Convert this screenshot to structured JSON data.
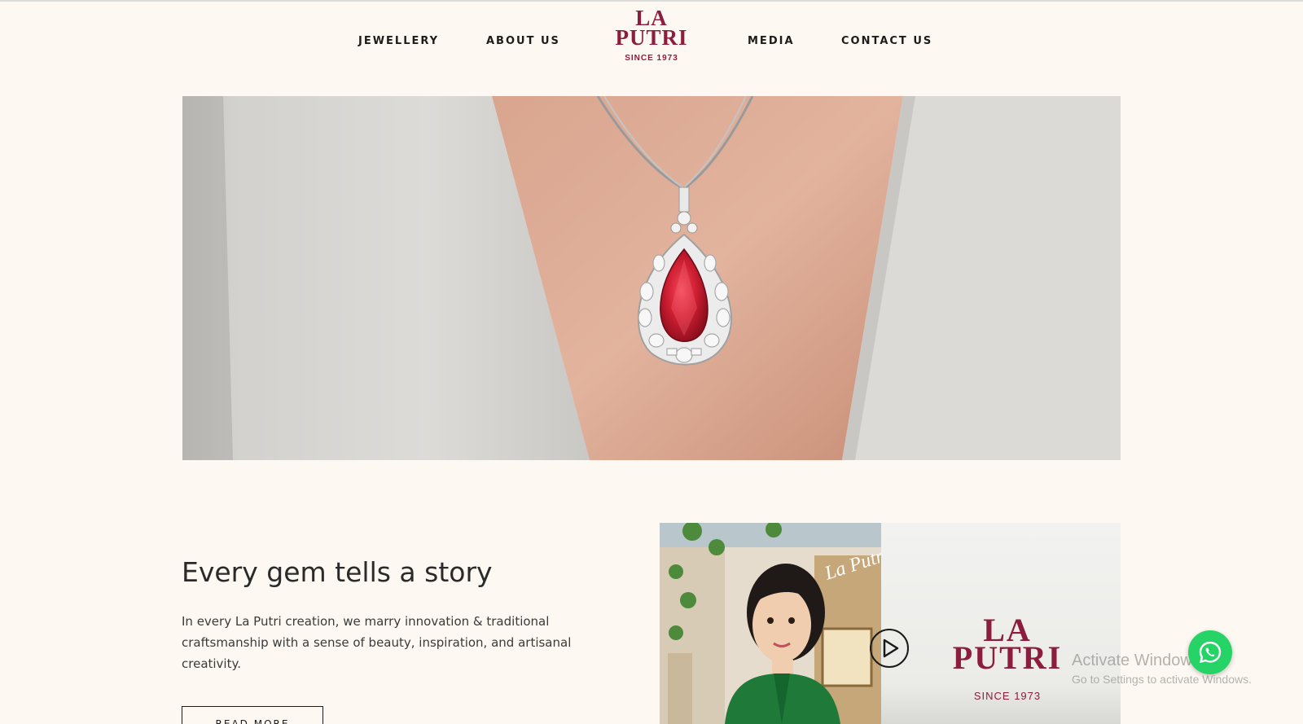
{
  "nav": {
    "left": [
      "JEWELLERY",
      "ABOUT US"
    ],
    "right": [
      "MEDIA",
      "CONTACT US"
    ]
  },
  "logo": {
    "line1": "LA",
    "line2": "PUTRI",
    "since": "SINCE 1973"
  },
  "hero": {
    "image_alt": "Ruby and diamond pendant necklace on model wearing white blazer"
  },
  "story": {
    "title": "Every gem tells a story",
    "text": "In every La Putri creation, we marry innovation & traditional craftsmanship with a sense of beauty, inspiration, and artisanal creativity.",
    "button": "READ MORE"
  },
  "video": {
    "store_sign": "La Putri",
    "logo_line1": "LA",
    "logo_line2": "PUTRI",
    "logo_since": "SINCE 1973",
    "play_icon": "play-icon"
  },
  "overlay": {
    "activate_title": "Activate Windows",
    "activate_sub": "Go to Settings to activate Windows."
  },
  "whatsapp": {
    "icon": "whatsapp-icon"
  },
  "colors": {
    "brand": "#8c1d3f",
    "background": "#fdf9f2",
    "whatsapp": "#25d366"
  }
}
